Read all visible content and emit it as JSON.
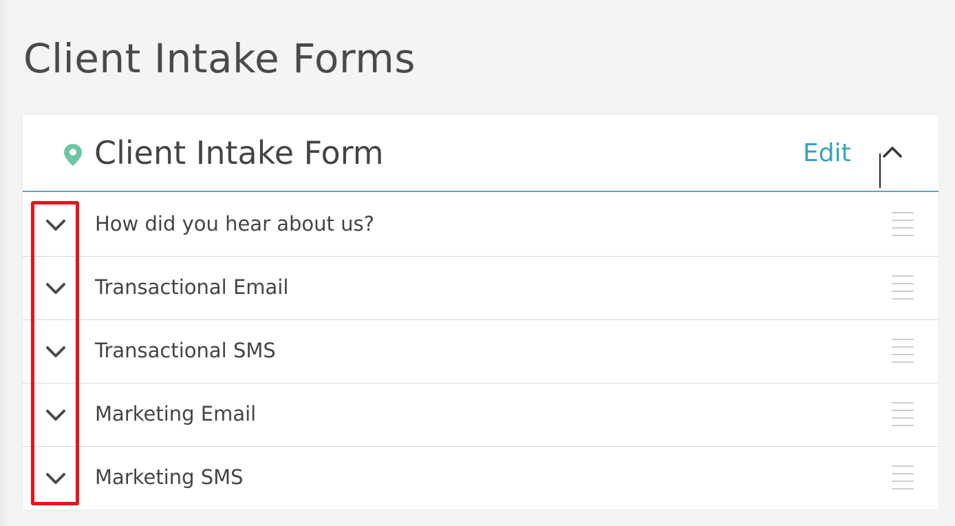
{
  "page": {
    "title": "Client Intake Forms"
  },
  "form_card": {
    "title": "Client Intake Form",
    "edit_label": "Edit",
    "icon": "location-pin-icon",
    "collapse_icon": "chevron-up-icon",
    "accent_color": "#3aa3b8",
    "pin_color": "#6cc7a0",
    "fields": [
      {
        "label": "How did you hear about us?",
        "toggle_icon": "chevron-down-icon",
        "handle_icon": "drag-handle-icon"
      },
      {
        "label": "Transactional Email",
        "toggle_icon": "chevron-down-icon",
        "handle_icon": "drag-handle-icon"
      },
      {
        "label": "Transactional SMS",
        "toggle_icon": "chevron-down-icon",
        "handle_icon": "drag-handle-icon"
      },
      {
        "label": "Marketing Email",
        "toggle_icon": "chevron-down-icon",
        "handle_icon": "drag-handle-icon"
      },
      {
        "label": "Marketing SMS",
        "toggle_icon": "chevron-down-icon",
        "handle_icon": "drag-handle-icon"
      }
    ]
  },
  "annotation": {
    "highlight_color": "#e8141c"
  }
}
